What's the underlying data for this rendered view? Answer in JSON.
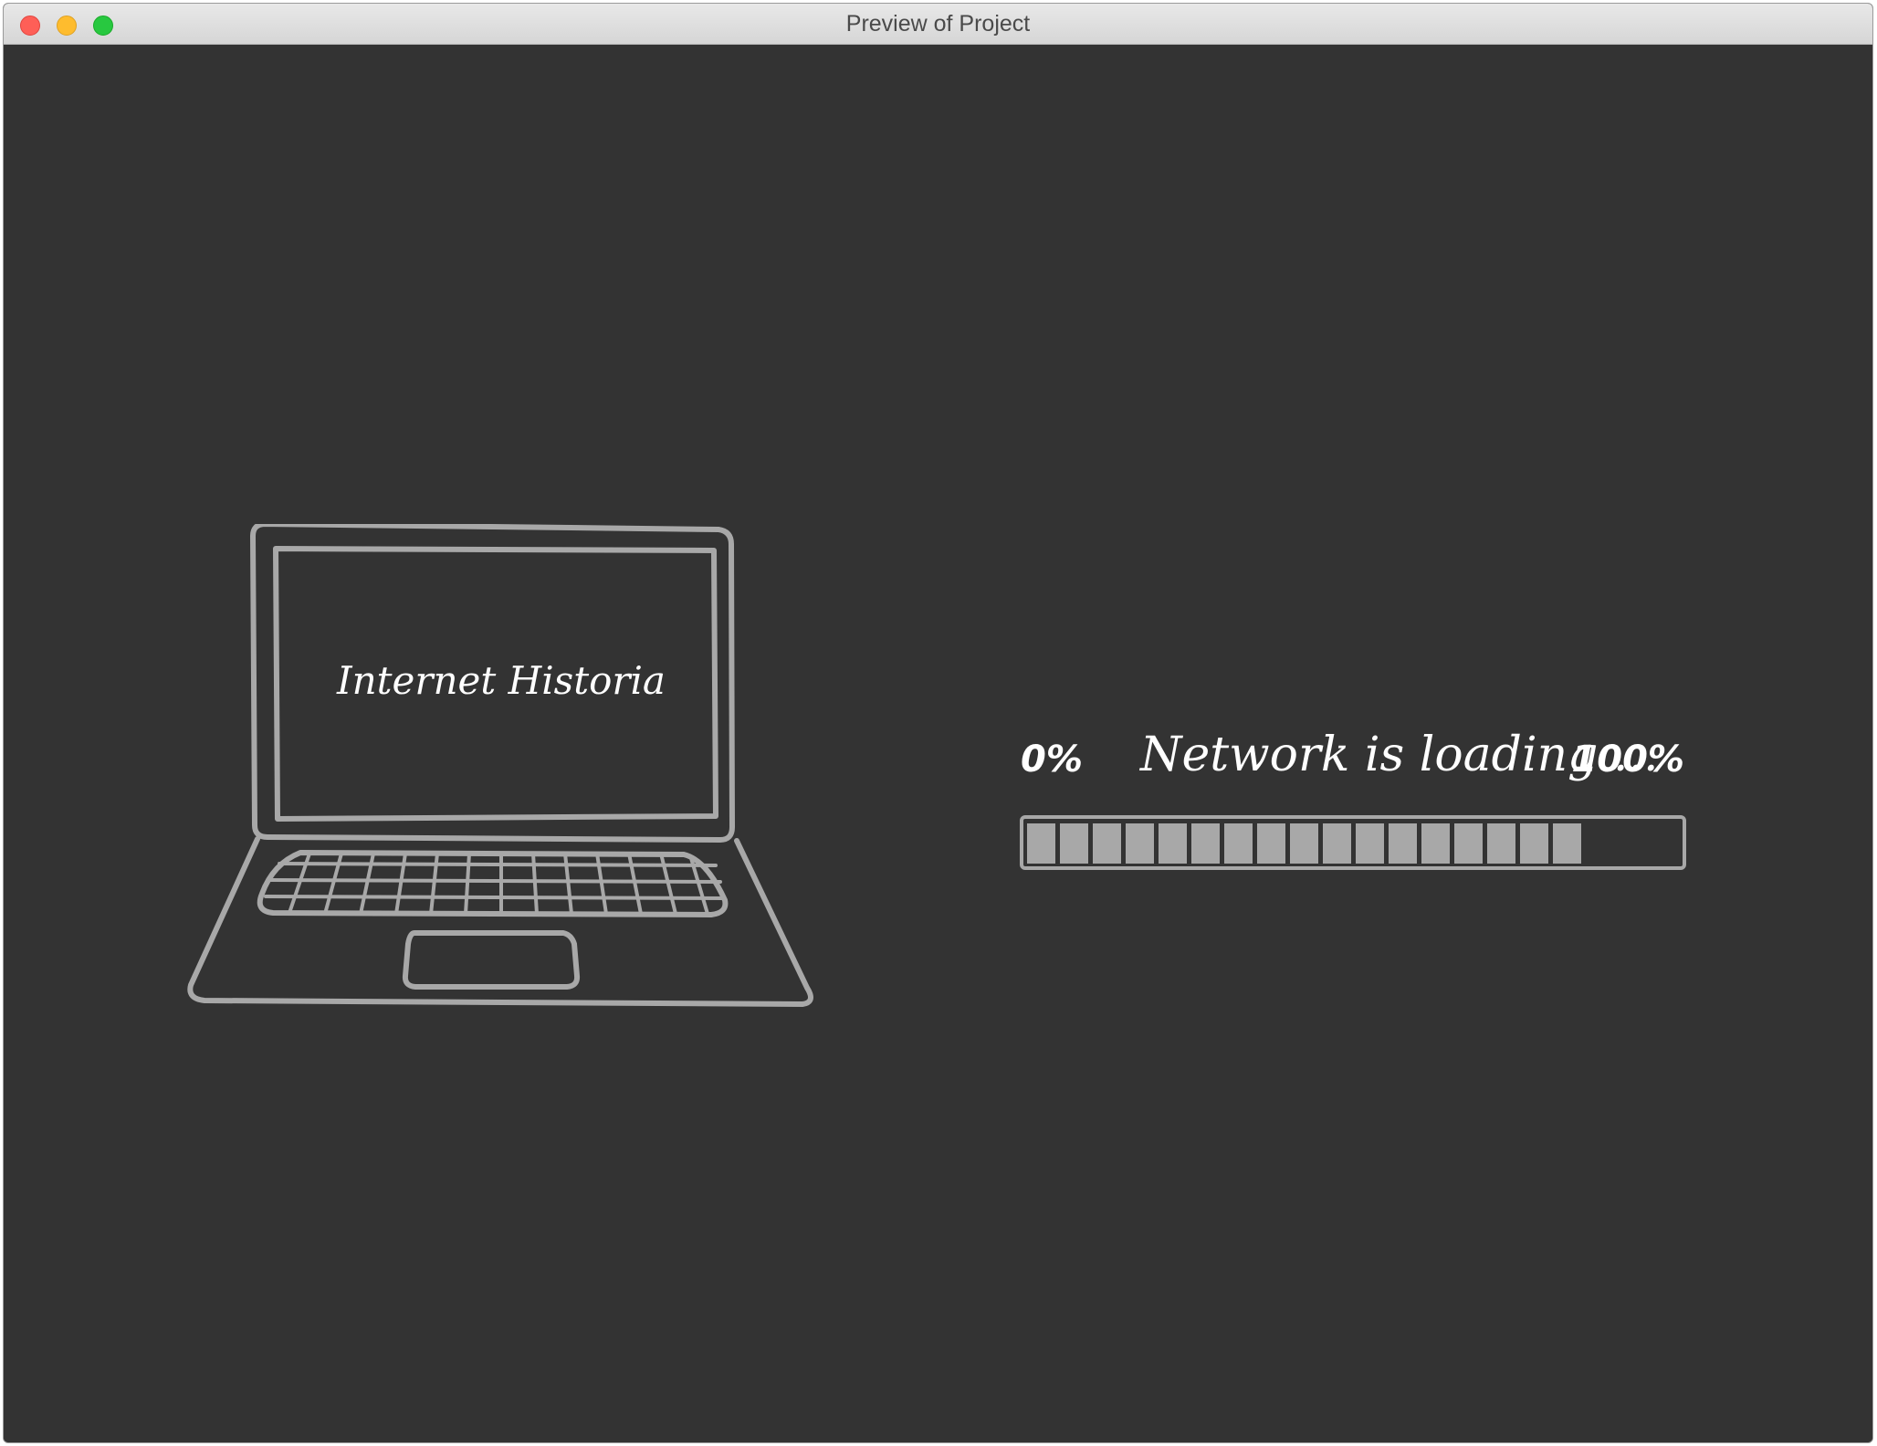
{
  "window": {
    "title": "Preview of Project"
  },
  "colors": {
    "background": "#333333",
    "stroke": "#a8a8a8",
    "text": "#ffffff"
  },
  "laptop": {
    "screen_text": "Internet Historia"
  },
  "loader": {
    "min_label": "0%",
    "max_label": "100%",
    "status_text": "Network is loading ...",
    "progress": 0.85,
    "segments_filled": 17
  }
}
